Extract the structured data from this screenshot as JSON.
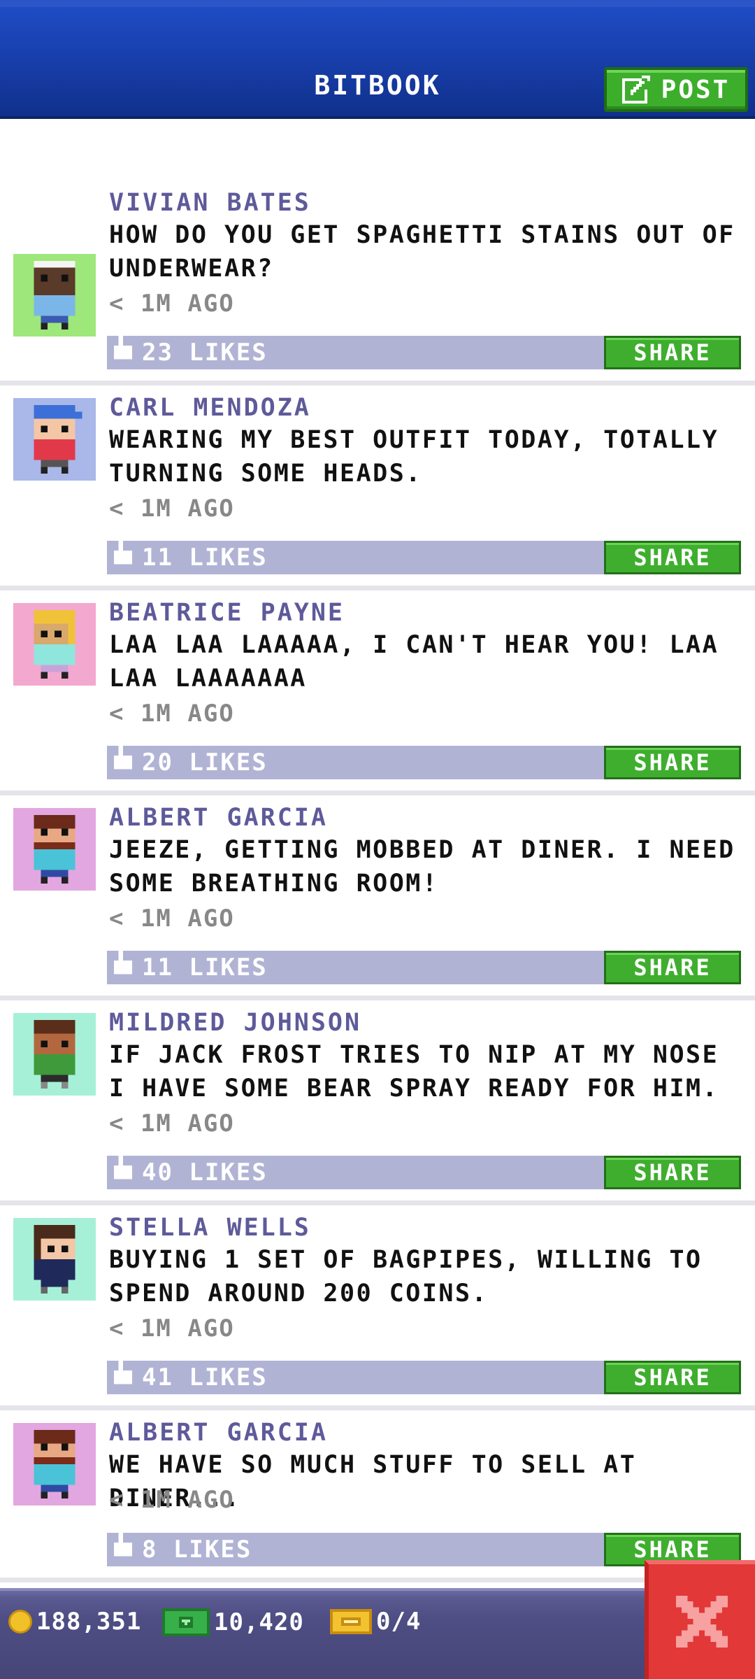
{
  "header": {
    "title": "BITBOOK",
    "post_label": "POST",
    "post_icon": "edit-icon"
  },
  "posts": [
    {
      "name": "VIVIAN BATES",
      "message": "HOW DO YOU GET SPAGHETTI STAINS OUT OF UNDERWEAR?",
      "time": "< 1M AGO",
      "likes": "23 LIKES",
      "share": "SHARE",
      "avatar_bg": "#9ee77a"
    },
    {
      "name": "CARL MENDOZA",
      "message": "WEARING MY BEST OUTFIT TODAY, TOTALLY TURNING SOME HEADS.",
      "time": "< 1M AGO",
      "likes": "11 LIKES",
      "share": "SHARE",
      "avatar_bg": "#a9b7e9"
    },
    {
      "name": "BEATRICE PAYNE",
      "message": "LAA LAA LAAAAA, I CAN'T HEAR YOU! LAA LAA LAAAAAAA",
      "time": "< 1M AGO",
      "likes": "20 LIKES",
      "share": "SHARE",
      "avatar_bg": "#f3a8cf"
    },
    {
      "name": "ALBERT GARCIA",
      "message": "JEEZE, GETTING MOBBED AT DINER. I NEED SOME BREATHING ROOM!",
      "time": "< 1M AGO",
      "likes": "11 LIKES",
      "share": "SHARE",
      "avatar_bg": "#e2a7e0"
    },
    {
      "name": "MILDRED JOHNSON",
      "message": "IF JACK FROST TRIES TO NIP AT MY NOSE I HAVE SOME BEAR SPRAY READY FOR HIM.",
      "time": "< 1M AGO",
      "likes": "40 LIKES",
      "share": "SHARE",
      "avatar_bg": "#a6f0d8"
    },
    {
      "name": "STELLA WELLS",
      "message": "BUYING 1 SET OF BAGPIPES, WILLING TO SPEND AROUND 200 COINS.",
      "time": "< 1M AGO",
      "likes": "41 LIKES",
      "share": "SHARE",
      "avatar_bg": "#a6f0d8"
    },
    {
      "name": "ALBERT GARCIA",
      "message": "WE HAVE SO MUCH STUFF TO SELL AT DINER...",
      "time": "< 1M AGO",
      "likes": "8 LIKES",
      "share": "SHARE",
      "avatar_bg": "#e2a7e0"
    }
  ],
  "status_bar": {
    "coins": "188,351",
    "bux": "10,420",
    "tickets": "0/4"
  },
  "close_icon": "close-x-icon"
}
